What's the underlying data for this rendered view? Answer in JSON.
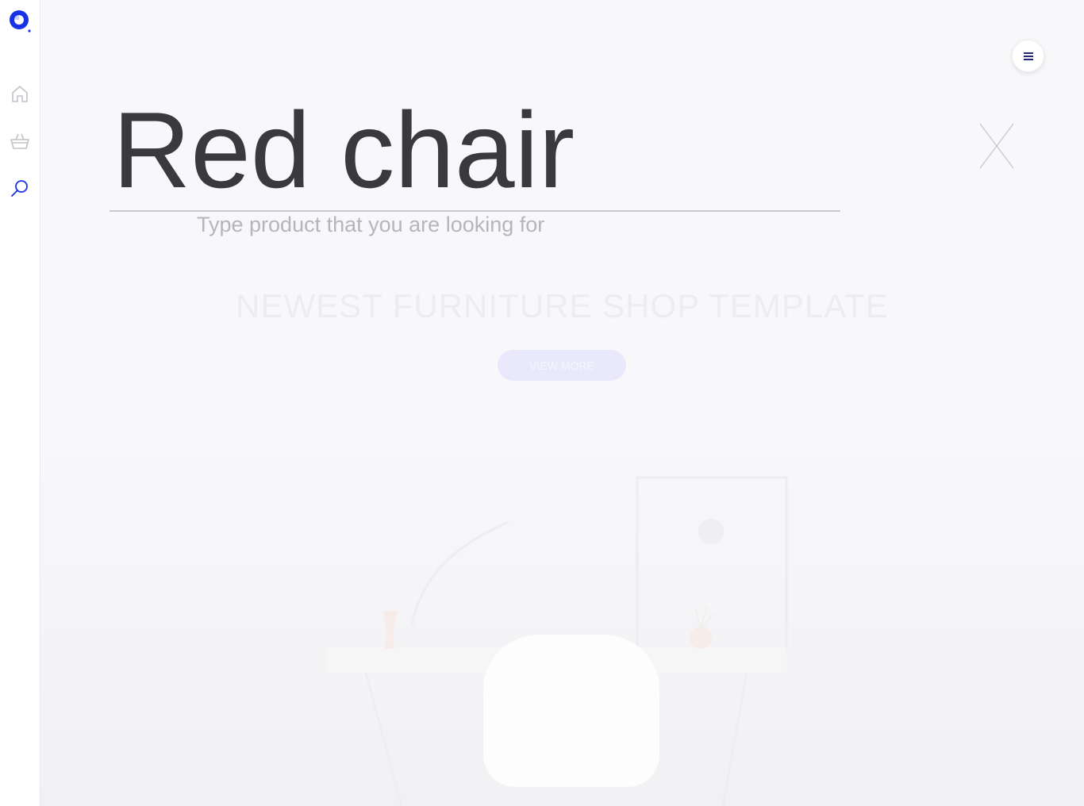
{
  "sidebar": {
    "logo": "logo-icon",
    "items": [
      {
        "icon": "home-icon"
      },
      {
        "icon": "basket-icon"
      },
      {
        "icon": "search-icon"
      }
    ],
    "accent_color": "#1a32e6",
    "inactive_color": "#c2c2c8"
  },
  "search": {
    "value": "Red chair",
    "hint": "Type product that you are looking for"
  },
  "hero": {
    "title": "NEWEST FURNITURE SHOP TEMPLATE",
    "button_label": "VIEW MORE"
  },
  "header": {
    "menu_icon": "hamburger-icon",
    "close_icon": "close-icon"
  }
}
